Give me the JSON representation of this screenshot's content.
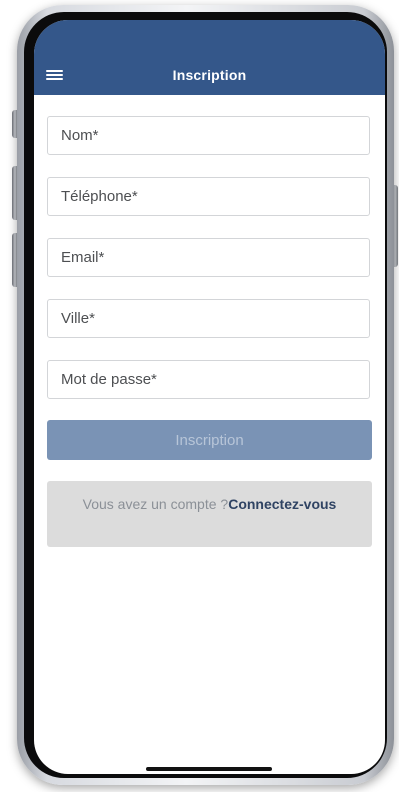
{
  "header": {
    "title": "Inscription",
    "menu_icon": "hamburger-menu-icon"
  },
  "form": {
    "fields": [
      {
        "placeholder": "Nom*",
        "value": ""
      },
      {
        "placeholder": "Téléphone*",
        "value": ""
      },
      {
        "placeholder": "Email*",
        "value": ""
      },
      {
        "placeholder": "Ville*",
        "value": ""
      },
      {
        "placeholder": "Mot de passe*",
        "value": ""
      }
    ],
    "submit_label": "Inscription"
  },
  "login_prompt": {
    "question": "Vous avez un compte ?",
    "link_label": "Connectez-vous"
  },
  "colors": {
    "appbar": "#34578a",
    "submit_button": "#7a93b5",
    "login_box": "#dcdcdc",
    "link": "#2f4363"
  }
}
